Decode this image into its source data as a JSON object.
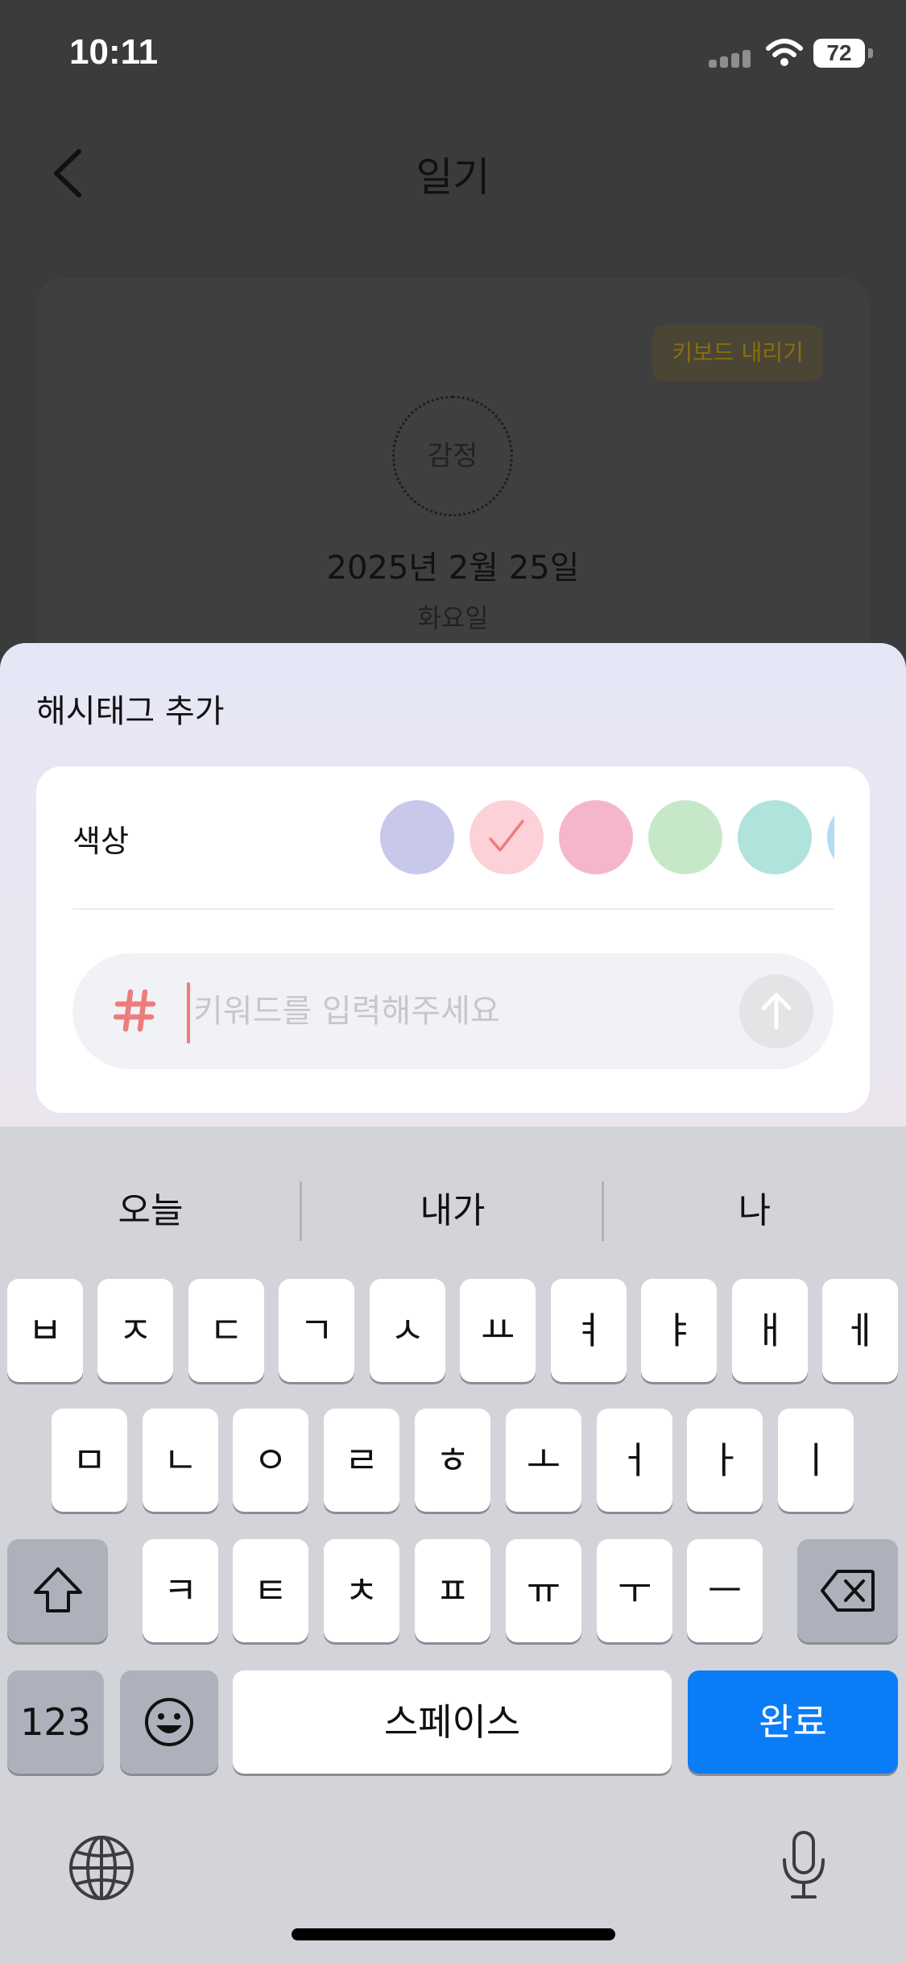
{
  "status_bar": {
    "time": "10:11",
    "battery": "72"
  },
  "nav": {
    "title": "일기",
    "back_icon": "chevron-left-icon"
  },
  "entry_card": {
    "keyboard_hide_label": "키보드 내리기",
    "emotion_label": "감정",
    "date": "2025년 2월 25일",
    "weekday": "화요일"
  },
  "sheet": {
    "title": "해시태그 추가",
    "color_label": "색상",
    "swatches": [
      {
        "color": "#c7c8ea",
        "selected": false
      },
      {
        "color": "#fcd1d7",
        "selected": true
      },
      {
        "color": "#f6b6c9",
        "selected": false
      },
      {
        "color": "#c7e8c8",
        "selected": false
      },
      {
        "color": "#b0e3db",
        "selected": false
      },
      {
        "color": "#b3dcf3",
        "selected": false
      }
    ],
    "input": {
      "placeholder": "키워드를 입력해주세요",
      "value": "",
      "prefix_icon": "hash-icon"
    },
    "send_icon": "arrow-up-icon",
    "accent_color": "#ee7c7c"
  },
  "keyboard": {
    "suggestions": [
      "오늘",
      "내가",
      "나"
    ],
    "row1": [
      "ㅂ",
      "ㅈ",
      "ㄷ",
      "ㄱ",
      "ㅅ",
      "ㅛ",
      "ㅕ",
      "ㅑ",
      "ㅐ",
      "ㅔ"
    ],
    "row2": [
      "ㅁ",
      "ㄴ",
      "ㅇ",
      "ㄹ",
      "ㅎ",
      "ㅗ",
      "ㅓ",
      "ㅏ",
      "ㅣ"
    ],
    "row3": [
      "ㅋ",
      "ㅌ",
      "ㅊ",
      "ㅍ",
      "ㅠ",
      "ㅜ",
      "ㅡ"
    ],
    "numbers_label": "123",
    "space_label": "스페이스",
    "done_label": "완료",
    "done_color": "#0a7cf6"
  }
}
